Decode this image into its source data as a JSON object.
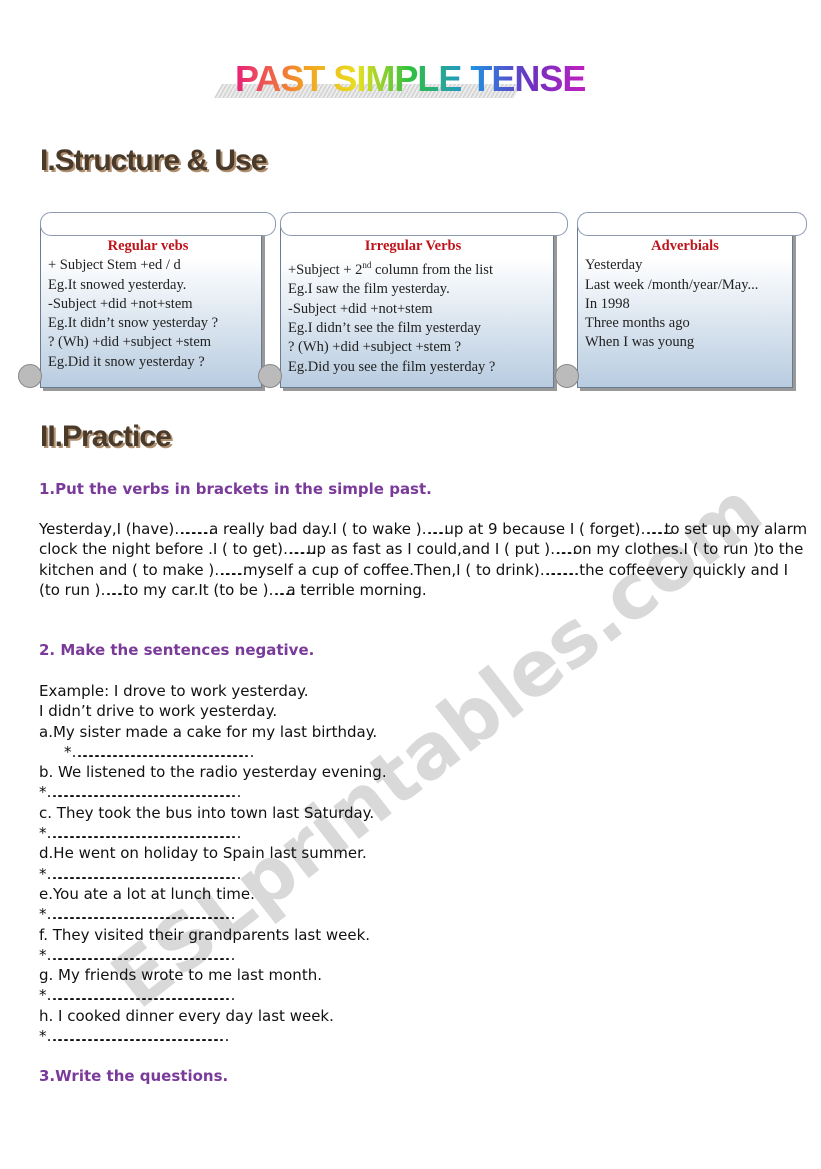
{
  "title": "PAST SIMPLE TENSE",
  "section1": "I.Structure & Use",
  "boxes": [
    {
      "heading": "Regular vebs",
      "lines": [
        "+ Subject Stem +ed / d",
        "Eg.It snowed yesterday.",
        "-Subject +did +not+stem",
        "Eg.It didn’t snow yesterday ?",
        "? (Wh) +did +subject +stem",
        "Eg.Did it snow yesterday ?"
      ]
    },
    {
      "heading": "Irregular Verbs",
      "lines": [
        "+Subject + 2nd column from the list",
        "Eg.I saw the film yesterday.",
        "-Subject +did +not+stem",
        "Eg.I didn’t see the film yesterday",
        "? (Wh) +did +subject +stem ?",
        "Eg.Did you see the film yesterday ?"
      ]
    },
    {
      "heading": "Adverbials",
      "lines": [
        "Yesterday",
        "Last week /month/year/May...",
        "In 1998",
        "Three months ago",
        "When I was young"
      ]
    }
  ],
  "section2": "II.Practice",
  "ex1": {
    "title": "1.Put the verbs in brackets in the simple past.",
    "text": "Yesterday,I (have)…………….a really bad day.I ( to wake )……….up at 9 because I ( forget)…………to set up my alarm clock the night before .I ( to get)…………up as fast as I could,and I ( put )……….on my clothes.I ( to run )to the kitchen and  ( to make )………….myself a cup of coffee.Then,I ( to drink)……………..the coffeevery quickly and I (to run )……….to my car.It (to be )………a terrible morning."
  },
  "ex2": {
    "title": "2. Make the sentences negative.",
    "lines": [
      "Example: I drove to work yesterday.",
      "I didn’t drive to work yesterday.",
      "a.My sister made a cake for my last birthday.",
      "     *……………………………………………………………………………",
      "b. We listened to the radio yesterday evening.",
      "*…………………………………………………………………………………",
      "c. They took the bus into town last Saturday.",
      "*…………………………………………………………………………………",
      "d.He went on holiday to Spain last summer.",
      "*…………………………………………………………………………………",
      "e.You ate a lot at lunch time.",
      "*………………………………………………………………………………",
      "f. They visited  their grandparents last week.",
      "*………………………………………………………………………………",
      "g. My friends wrote to me last month.",
      "*………………………………………………………………………………",
      "h. I cooked dinner every day last week.",
      "*……………………………………………………………………………"
    ]
  },
  "ex3": {
    "title": "3.Write the questions."
  },
  "watermark": "ESLprintables.com"
}
